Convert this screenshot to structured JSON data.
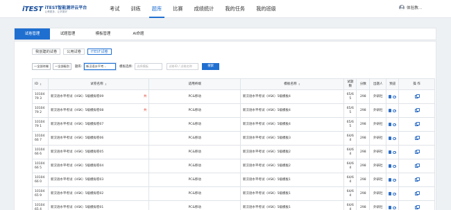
{
  "header": {
    "logo_mark": "iTEST",
    "logo_title": "iTEST智能测评云平台",
    "logo_sub": "让教更多，让学更好",
    "nav": [
      {
        "label": "考试",
        "active": false
      },
      {
        "label": "训练",
        "active": false
      },
      {
        "label": "题库",
        "active": true
      },
      {
        "label": "比赛",
        "active": false
      },
      {
        "label": "成绩统计",
        "active": false
      },
      {
        "label": "我的任务",
        "active": false
      },
      {
        "label": "我的班级",
        "active": false
      }
    ],
    "user_name": "体验教..."
  },
  "subtabs": [
    "试卷管理",
    "试题管理",
    "模板管理",
    "AI命题"
  ],
  "scopes": [
    "我创建的试卷",
    "公用试卷",
    "ITEST试卷"
  ],
  "filters": {
    "level1": "一全部终端",
    "level2": "一全部级别",
    "item_label": "题库:",
    "item_value": "新汉语水平考...",
    "template_label": "模板选择:",
    "template_placeholder": "选择模板",
    "keyword_placeholder": "试卷ID / 试卷名称",
    "search_label": "搜索"
  },
  "table": {
    "headers": {
      "id": "ID",
      "name": "试卷名称",
      "terminal": "适用终端",
      "template": "模板名称",
      "count": "试题数",
      "score": "分数",
      "publisher": "出题人",
      "preview": "预览",
      "ops": "操 作"
    },
    "rows": [
      {
        "id": "1010479 3",
        "name": "新汉语水平考试（HSK）5级模拟卷09",
        "tag": "共",
        "terminal": "PC&移动",
        "template": "新汉语水平考试（HSK）5级模板4",
        "count": "65/6 5",
        "score": "298",
        "publisher": "外研社"
      },
      {
        "id": "1010479 2",
        "name": "新汉语水平考试（HSK）5级模拟卷08",
        "tag": "共",
        "terminal": "PC&移动",
        "template": "新汉语水平考试（HSK）5级模板4",
        "count": "65/6 5",
        "score": "298",
        "publisher": "外研社"
      },
      {
        "id": "1010479 1",
        "name": "新汉语水平考试（HSK）5级模拟卷07",
        "tag": "",
        "terminal": "PC&移动",
        "template": "新汉语水平考试（HSK）5级模板4",
        "count": "65/6 5",
        "score": "298",
        "publisher": "外研社"
      },
      {
        "id": "1010466 7",
        "name": "新汉语水平考试（HSK）5级模拟卷06",
        "tag": "",
        "terminal": "PC&移动",
        "template": "新汉语水平考试（HSK）5级模板3",
        "count": "64/6 4",
        "score": "298",
        "publisher": "外研社"
      },
      {
        "id": "1010466 6",
        "name": "新汉语水平考试（HSK）5级模拟卷05",
        "tag": "",
        "terminal": "PC&移动",
        "template": "新汉语水平考试（HSK）5级模板2",
        "count": "64/6 4",
        "score": "298",
        "publisher": "外研社"
      },
      {
        "id": "1010466 5",
        "name": "新汉语水平考试（HSK）5级模拟卷04",
        "tag": "",
        "terminal": "PC&移动",
        "template": "新汉语水平考试（HSK）5级模板2",
        "count": "64/6 4",
        "score": "298",
        "publisher": "外研社"
      },
      {
        "id": "1010466 0",
        "name": "新汉语水平考试（HSK）5级模拟卷03",
        "tag": "",
        "terminal": "PC&移动",
        "template": "新汉语水平考试（HSK）5级模板1",
        "count": "64/6 4",
        "score": "298",
        "publisher": "外研社"
      },
      {
        "id": "1010465 9",
        "name": "新汉语水平考试（HSK）5级模拟卷02",
        "tag": "",
        "terminal": "PC&移动",
        "template": "新汉语水平考试（HSK）5级模板1",
        "count": "64/6 4",
        "score": "298",
        "publisher": "外研社"
      },
      {
        "id": "1010465 4",
        "name": "新汉语水平考试（HSK）5级模拟卷01",
        "tag": "",
        "terminal": "PC&移动",
        "template": "新汉语水平考试（HSK）5级模板1",
        "count": "64/6 4",
        "score": "298",
        "publisher": "外研社"
      }
    ]
  },
  "icons": [
    "user-avatar-icon",
    "book-icon",
    "eye-icon",
    "copy-icon",
    "sort-icon"
  ],
  "colors": {
    "accent": "#1f6fd0",
    "tag": "#e04a3a"
  }
}
